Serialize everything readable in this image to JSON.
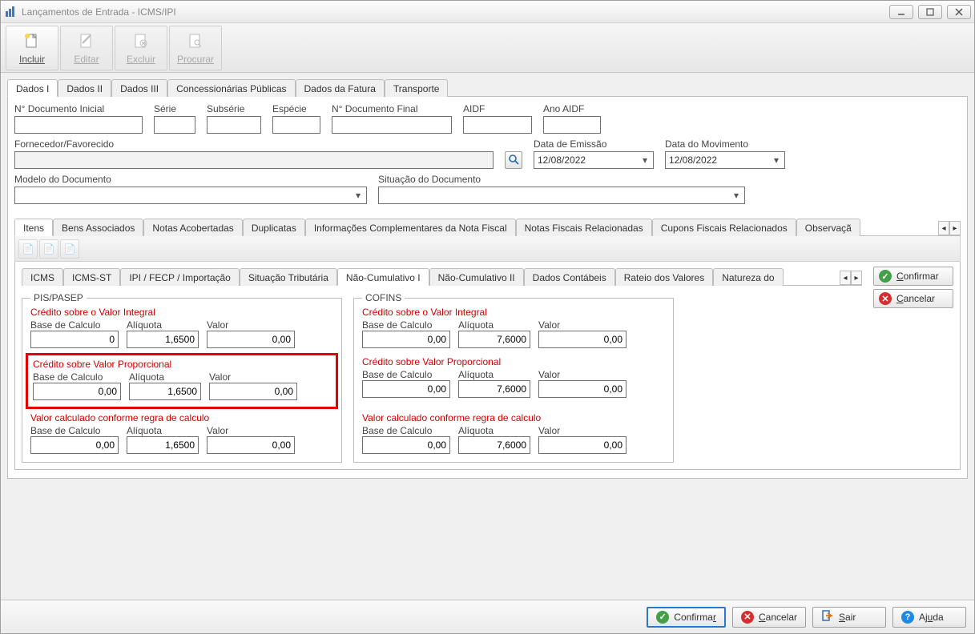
{
  "window": {
    "title": "Lançamentos de Entrada - ICMS/IPI"
  },
  "toolbar": {
    "incluir": "Incluir",
    "editar": "Editar",
    "excluir": "Excluir",
    "procurar": "Procurar"
  },
  "mainTabs": [
    "Dados I",
    "Dados II",
    "Dados III",
    "Concessionárias Públicas",
    "Dados da Fatura",
    "Transporte"
  ],
  "dados1": {
    "nDocInicial_label": "N° Documento Inicial",
    "serie_label": "Série",
    "subserie_label": "Subsérie",
    "especie_label": "Espécie",
    "nDocFinal_label": "N° Documento Final",
    "aidf_label": "AIDF",
    "anoAidf_label": "Ano AIDF",
    "fornecedor_label": "Fornecedor/Favorecido",
    "dataEmissao_label": "Data de Emissão",
    "dataEmissao_value": "12/08/2022",
    "dataMovimento_label": "Data do Movimento",
    "dataMovimento_value": "12/08/2022",
    "modeloDoc_label": "Modelo do Documento",
    "situacaoDoc_label": "Situação do Documento"
  },
  "subTabs": [
    "Itens",
    "Bens Associados",
    "Notas Acobertadas",
    "Duplicatas",
    "Informações Complementares da Nota Fiscal",
    "Notas Fiscais Relacionadas",
    "Cupons Fiscais Relacionados",
    "Observaçã"
  ],
  "innerTabs": [
    "ICMS",
    "ICMS-ST",
    "IPI / FECP / Importação",
    "Situação Tributária",
    "Não-Cumulativo I",
    "Não-Cumulativo II",
    "Dados Contábeis",
    "Rateio dos Valores",
    "Natureza do"
  ],
  "labels": {
    "baseCalculo": "Base de Calculo",
    "aliquota": "Alíquota",
    "valor": "Valor",
    "credIntegral": "Crédito sobre o Valor Integral",
    "credProporcional": "Crédito sobre Valor Proporcional",
    "valorCalcRegra": "Valor calculado conforme regra de calculo"
  },
  "pis": {
    "legend": "PIS/PASEP",
    "integral": {
      "base": "0",
      "aliq": "1,6500",
      "valor": "0,00"
    },
    "proporcional": {
      "base": "0,00",
      "aliq": "1,6500",
      "valor": "0,00"
    },
    "regra": {
      "base": "0,00",
      "aliq": "1,6500",
      "valor": "0,00"
    }
  },
  "cofins": {
    "legend": "COFINS",
    "integral": {
      "base": "0,00",
      "aliq": "7,6000",
      "valor": "0,00"
    },
    "proporcional": {
      "base": "0,00",
      "aliq": "7,6000",
      "valor": "0,00"
    },
    "regra": {
      "base": "0,00",
      "aliq": "7,6000",
      "valor": "0,00"
    }
  },
  "sideButtons": {
    "confirmar": "Confirmar",
    "cancelar": "Cancelar"
  },
  "bottomButtons": {
    "confirmar": "Confirmar",
    "cancelar": "Cancelar",
    "sair": "Sair",
    "ajuda": "Ajuda"
  }
}
